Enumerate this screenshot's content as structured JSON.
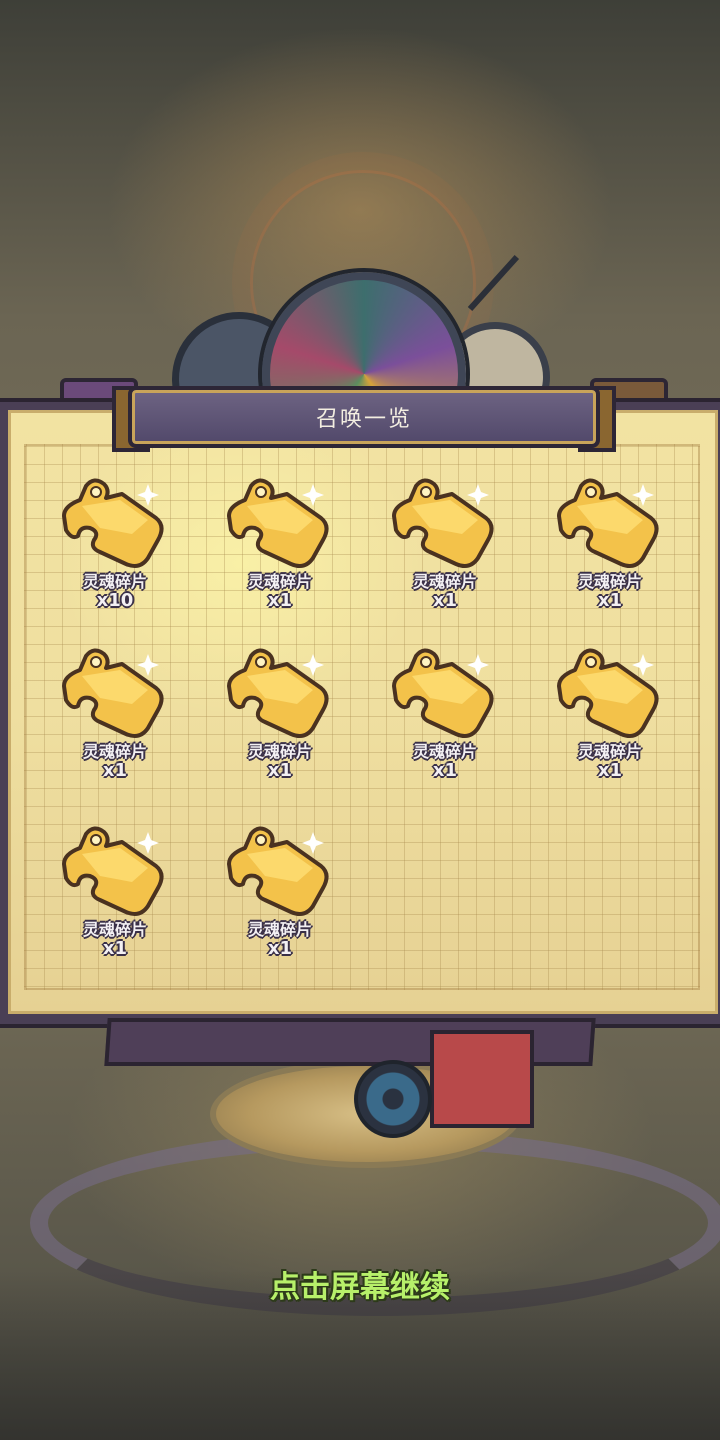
{
  "title": "召唤一览",
  "continue_hint": "点击屏幕继续",
  "colors": {
    "panel": "#efdfa0",
    "title_bar": "#5a5072",
    "hint": "#b7f06a",
    "piece_gold": "#f3c24a"
  },
  "items": [
    {
      "icon": "gold-puzzle-piece-icon",
      "name": "灵魂碎片",
      "qty": "x10"
    },
    {
      "icon": "gold-puzzle-piece-icon",
      "name": "灵魂碎片",
      "qty": "x1"
    },
    {
      "icon": "gold-puzzle-piece-icon",
      "name": "灵魂碎片",
      "qty": "x1"
    },
    {
      "icon": "gold-puzzle-piece-icon",
      "name": "灵魂碎片",
      "qty": "x1"
    },
    {
      "icon": "gold-puzzle-piece-icon",
      "name": "灵魂碎片",
      "qty": "x1"
    },
    {
      "icon": "gold-puzzle-piece-icon",
      "name": "灵魂碎片",
      "qty": "x1"
    },
    {
      "icon": "gold-puzzle-piece-icon",
      "name": "灵魂碎片",
      "qty": "x1"
    },
    {
      "icon": "gold-puzzle-piece-icon",
      "name": "灵魂碎片",
      "qty": "x1"
    },
    {
      "icon": "gold-puzzle-piece-icon",
      "name": "灵魂碎片",
      "qty": "x1"
    },
    {
      "icon": "gold-puzzle-piece-icon",
      "name": "灵魂碎片",
      "qty": "x1"
    }
  ]
}
